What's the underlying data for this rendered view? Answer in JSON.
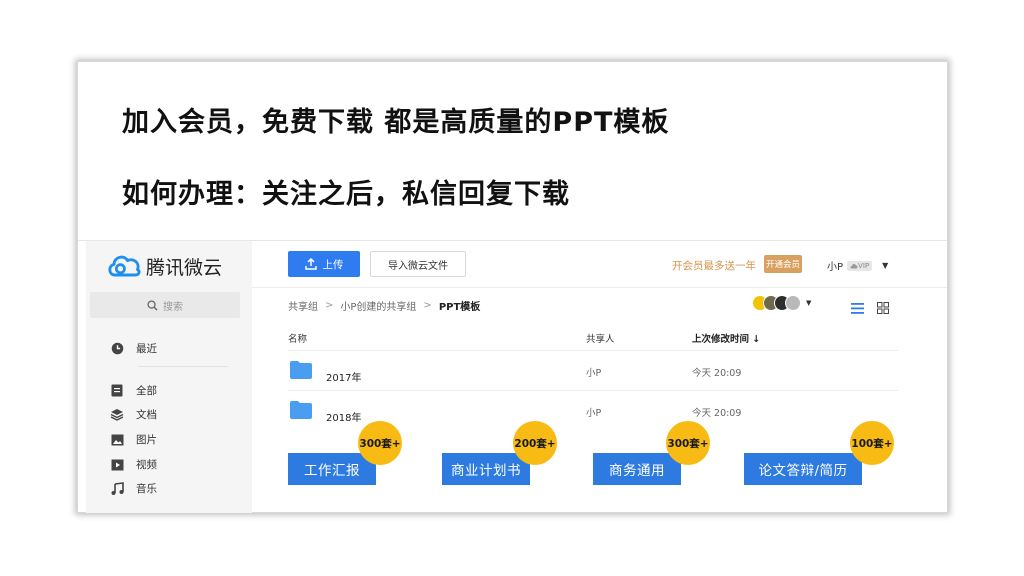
{
  "headline": {
    "line1": "加入会员，免费下载  都是高质量的PPT模板",
    "line2": "如何办理：关注之后，私信回复下载"
  },
  "app": {
    "brand": "腾讯微云",
    "search_placeholder": "搜索",
    "nav": [
      {
        "label": "最近",
        "icon": "clock-icon"
      },
      {
        "label": "全部",
        "icon": "file-icon"
      },
      {
        "label": "文档",
        "icon": "layers-icon"
      },
      {
        "label": "图片",
        "icon": "image-icon"
      },
      {
        "label": "视频",
        "icon": "video-icon"
      },
      {
        "label": "音乐",
        "icon": "music-icon"
      }
    ],
    "toolbar": {
      "upload_label": "上传",
      "import_label": "导入微云文件",
      "promo_text": "开会员最多送一年",
      "vip_button": "开通会员",
      "username": "小P",
      "vip_badge": "VIP"
    },
    "breadcrumb": [
      "共享组",
      "小P创建的共享组",
      "PPT模板"
    ],
    "table": {
      "headers": {
        "name": "名称",
        "sharer": "共享人",
        "modified": "上次修改时间 ↓"
      },
      "rows": [
        {
          "name": "2017年",
          "sharer": "小P",
          "modified": "今天 20:09"
        },
        {
          "name": "2018年",
          "sharer": "小P",
          "modified": "今天 20:09"
        }
      ]
    },
    "categories": [
      {
        "label": "工作汇报",
        "badge": "300套+"
      },
      {
        "label": "商业计划书",
        "badge": "200套+"
      },
      {
        "label": "商务通用",
        "badge": "300套+"
      },
      {
        "label": "论文答辩/简历",
        "badge": "100套+"
      }
    ]
  },
  "colors": {
    "primary_blue": "#2f7bf0",
    "badge_yellow": "#f7bb14",
    "vip_gold": "#d9a15f",
    "folder_blue": "#4a9df0"
  }
}
